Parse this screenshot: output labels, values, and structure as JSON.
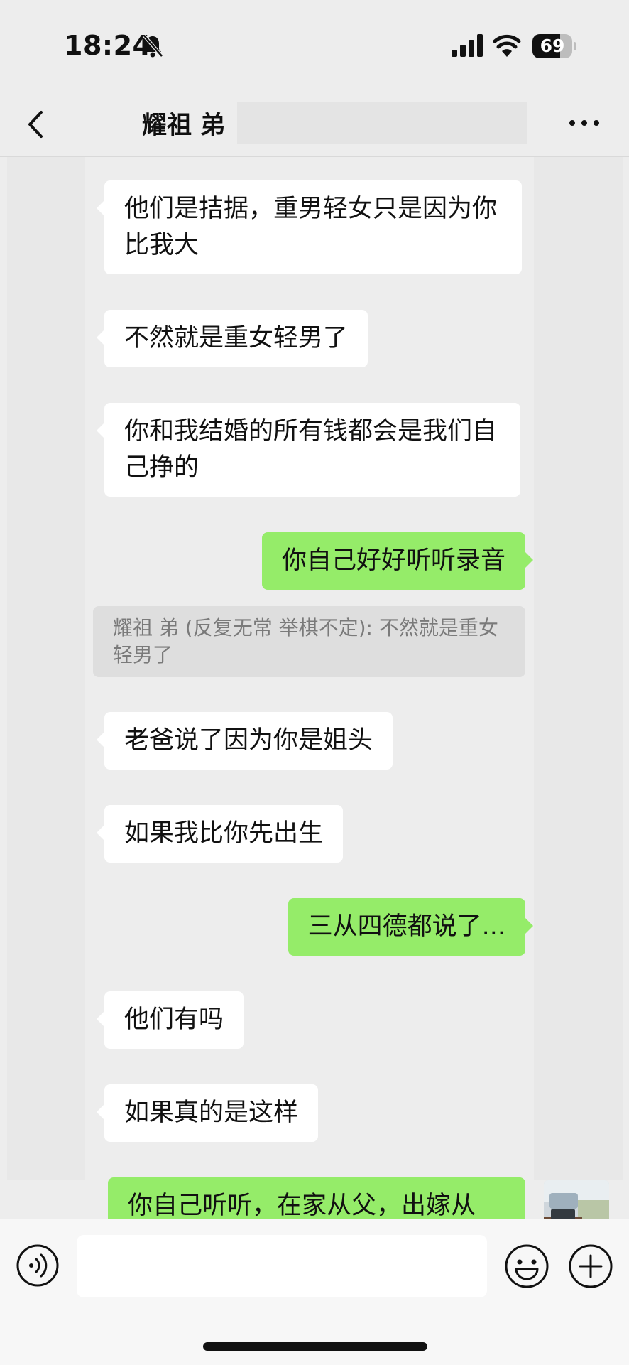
{
  "status_bar": {
    "time": "18:24",
    "battery_level": "69",
    "battery_fraction": 0.69
  },
  "nav": {
    "title": "耀祖 弟"
  },
  "messages": [
    {
      "side": "in",
      "text": "他们是拮据，重男轻女只是因为你比我大"
    },
    {
      "side": "in",
      "text": "不然就是重女轻男了"
    },
    {
      "side": "in",
      "text": "你和我结婚的所有钱都会是我们自己挣的"
    },
    {
      "side": "out",
      "text": "你自己好好听听录音"
    },
    {
      "side": "quote",
      "text": "耀祖 弟 (反复无常 举棋不定): 不然就是重女轻男了"
    },
    {
      "side": "in",
      "text": "老爸说了因为你是姐头"
    },
    {
      "side": "in",
      "text": "如果我比你先出生"
    },
    {
      "side": "out",
      "text": "三从四德都说了..."
    },
    {
      "side": "in",
      "text": "他们有吗"
    },
    {
      "side": "in",
      "text": "如果真的是这样"
    },
    {
      "side": "out",
      "text": "你自己听听，在家从父，出嫁从"
    }
  ],
  "input": {
    "value": "",
    "placeholder": ""
  },
  "colors": {
    "background": "#ededed",
    "incoming_bubble": "#ffffff",
    "outgoing_bubble": "#95ec69",
    "quote_background": "#dedede",
    "quote_text": "#7a7a7a"
  },
  "icons": [
    "bell-slash-icon",
    "signal-icon",
    "wifi-icon",
    "battery-icon",
    "back-chevron-icon",
    "more-dots-icon",
    "voice-icon",
    "emoji-icon",
    "plus-icon"
  ]
}
